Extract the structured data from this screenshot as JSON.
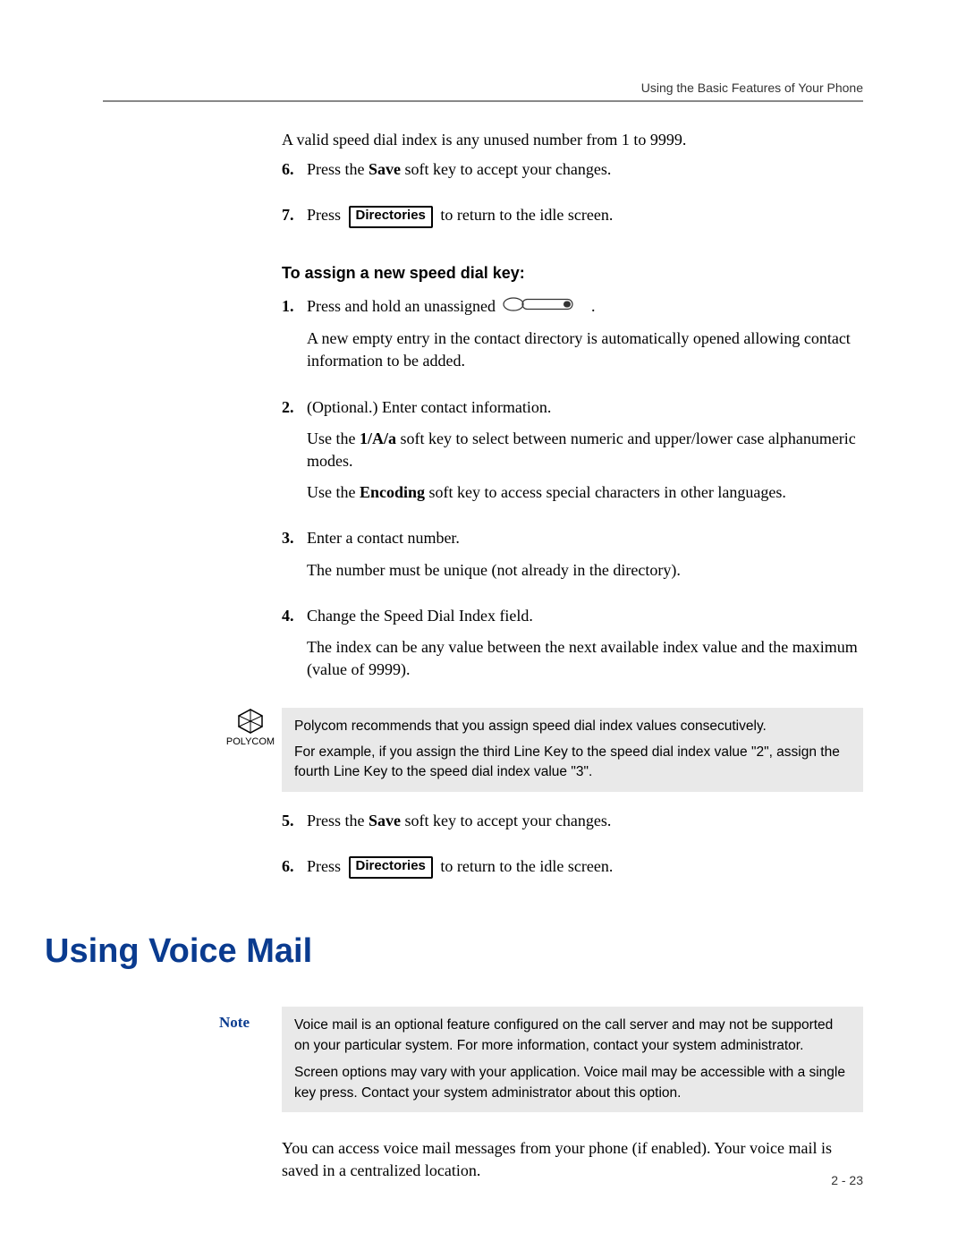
{
  "runningHead": "Using the Basic Features of Your Phone",
  "intro": "A valid speed dial index is any unused number from 1 to 9999.",
  "stepsA": {
    "s6": {
      "num": "6.",
      "pre": "Press the ",
      "bold": "Save",
      "post": " soft key to accept your changes."
    },
    "s7": {
      "num": "7.",
      "pre": "Press ",
      "key": "Directories",
      "post": " to return to the idle screen."
    }
  },
  "subhead": "To assign a new speed dial key:",
  "stepsB": {
    "s1": {
      "num": "1.",
      "line1_pre": "Press and hold an unassigned ",
      "line1_post": ".",
      "p2": "A new empty entry in the contact directory is automatically opened allowing contact information to be added."
    },
    "s2": {
      "num": "2.",
      "p1": "(Optional.) Enter contact information.",
      "p2_pre": "Use the ",
      "p2_bold": "1/A/a",
      "p2_post": " soft key to select between numeric and upper/lower case alphanumeric modes.",
      "p3_pre": "Use the ",
      "p3_bold": "Encoding",
      "p3_post": " soft key to access special characters in other languages."
    },
    "s3": {
      "num": "3.",
      "p1": "Enter a contact number.",
      "p2": "The number must be unique (not already in the directory)."
    },
    "s4": {
      "num": "4.",
      "p1": "Change the Speed Dial Index field.",
      "p2": "The index can be any value between the next available index value and the maximum (value of 9999)."
    },
    "s5": {
      "num": "5.",
      "pre": "Press the ",
      "bold": "Save",
      "post": " soft key to accept your changes."
    },
    "s6": {
      "num": "6.",
      "pre": "Press ",
      "key": "Directories",
      "post": " to return to the idle screen."
    }
  },
  "polycomLabel": "POLYCOM",
  "polycomTip": {
    "p1": "Polycom recommends that you assign speed dial index values consecutively.",
    "p2": "For example, if you assign the third Line Key to the speed dial index value \"2\", assign the fourth Line Key to the speed dial index value \"3\"."
  },
  "sectionTitle": "Using Voice Mail",
  "noteLabel": "Note",
  "noteBox": {
    "p1": "Voice mail is an optional feature configured on the call server and may not be supported on your particular system. For more information, contact your system administrator.",
    "p2": "Screen options may vary with your application. Voice mail may be accessible with a single key press. Contact your system administrator about this option."
  },
  "closingPara": "You can access voice mail messages from your phone (if enabled). Your voice mail is saved in a centralized location.",
  "pageNum": "2 - 23"
}
